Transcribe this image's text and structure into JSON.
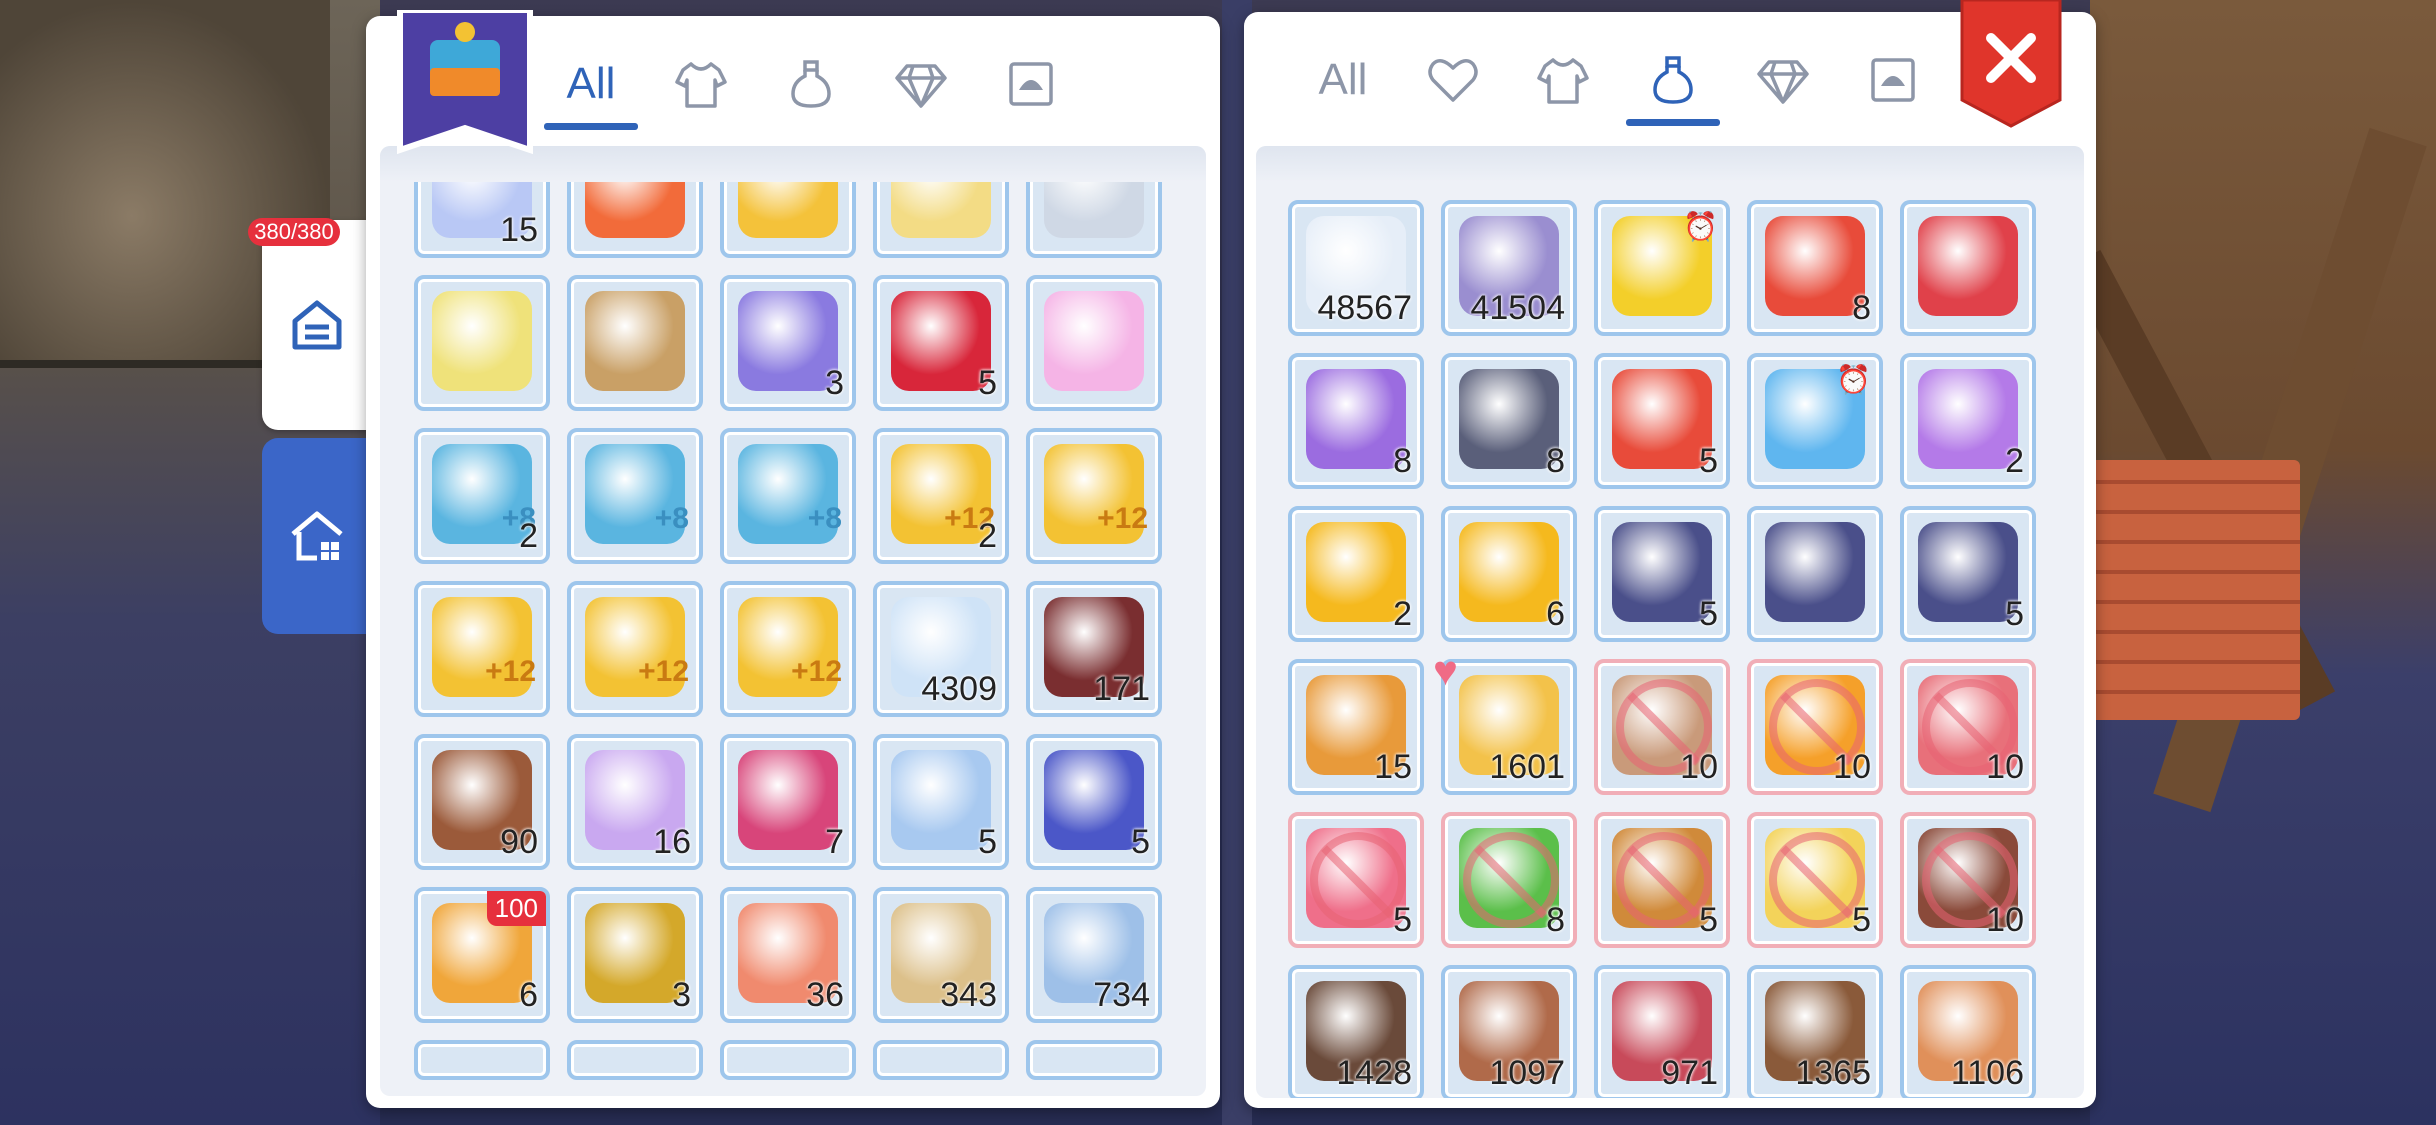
{
  "hud": {
    "hp_badge": "380/380"
  },
  "left_panel": {
    "tabs": [
      {
        "label": "All",
        "icon": "all-text",
        "active": true
      },
      {
        "label": "",
        "icon": "shirt-icon",
        "active": false
      },
      {
        "label": "",
        "icon": "potion-icon",
        "active": false
      },
      {
        "label": "",
        "icon": "diamond-icon",
        "active": false
      },
      {
        "label": "",
        "icon": "card-icon",
        "active": false
      }
    ],
    "items": [
      {
        "icon": "crystal-vial-icon",
        "count": "15",
        "color": "#b9c8f5"
      },
      {
        "icon": "red-ticket-icon",
        "count": "",
        "color": "#f26b3a"
      },
      {
        "icon": "gold-ticket-icon",
        "count": "",
        "color": "#f4c23a"
      },
      {
        "icon": "pale-gold-ticket-icon",
        "count": "",
        "color": "#f3dc85"
      },
      {
        "icon": "silver-ticket-icon",
        "count": "",
        "color": "#cfd8e5"
      },
      {
        "icon": "yellow-ticket-icon",
        "count": "",
        "color": "#efe27a"
      },
      {
        "icon": "brown-ticket-icon",
        "count": "",
        "color": "#c9a066"
      },
      {
        "icon": "blueprint-card-icon",
        "count": "3",
        "color": "#8a7ae0"
      },
      {
        "icon": "red-rose-icon",
        "count": "5",
        "color": "#d8263a"
      },
      {
        "icon": "pink-perfume-icon",
        "count": "",
        "color": "#f5b4e6"
      },
      {
        "icon": "blue-upgrade-boots-icon",
        "count": "2",
        "plus": "+8",
        "color": "#5ab5e0"
      },
      {
        "icon": "blue-upgrade-armor-icon",
        "count": "",
        "plus": "+8",
        "color": "#5ab5e0"
      },
      {
        "icon": "blue-upgrade-sword-icon",
        "count": "",
        "plus": "+8",
        "color": "#5ab5e0"
      },
      {
        "icon": "gold-upgrade-ring-icon",
        "count": "2",
        "plus": "+12",
        "color": "#f3c233"
      },
      {
        "icon": "gold-upgrade-boots-icon",
        "count": "",
        "plus": "+12",
        "color": "#f3c233"
      },
      {
        "icon": "gold-upgrade-cape-icon",
        "count": "",
        "plus": "+12",
        "color": "#f3c233"
      },
      {
        "icon": "gold-upgrade-armor-icon",
        "count": "",
        "plus": "+12",
        "color": "#f3c233"
      },
      {
        "icon": "gold-upgrade-shield-icon",
        "count": "",
        "plus": "+12",
        "color": "#f3c233"
      },
      {
        "icon": "ice-crystal-icon",
        "count": "4309",
        "color": "#cfe3f7"
      },
      {
        "icon": "bento-box-icon",
        "count": "171",
        "color": "#7a2e30"
      },
      {
        "icon": "lunch-box-icon",
        "count": "90",
        "color": "#9b5a3a"
      },
      {
        "icon": "purple-ghost-card-icon",
        "count": "16",
        "color": "#c9a8f0"
      },
      {
        "icon": "devil-book-icon",
        "count": "7",
        "color": "#d8457a"
      },
      {
        "icon": "crystal-scroll-icon",
        "count": "5",
        "color": "#a8c9f0"
      },
      {
        "icon": "star-wand-icon",
        "count": "5",
        "color": "#4b57c8"
      },
      {
        "icon": "gift-chest-icon",
        "count": "6",
        "badge": "100",
        "color": "#f0a63a"
      },
      {
        "icon": "gold-bar-icon",
        "count": "3",
        "color": "#d4a82a"
      },
      {
        "icon": "coral-ring-icon",
        "count": "36",
        "color": "#f08a6e"
      },
      {
        "icon": "parchment-map-icon",
        "count": "343",
        "color": "#dcc08a"
      },
      {
        "icon": "blue-cloth-icon",
        "count": "734",
        "color": "#9ec0e8"
      }
    ]
  },
  "right_panel": {
    "tabs": [
      {
        "label": "All",
        "icon": "all-text",
        "active": false
      },
      {
        "label": "",
        "icon": "heart-icon",
        "active": false
      },
      {
        "label": "",
        "icon": "shirt-icon",
        "active": false
      },
      {
        "label": "",
        "icon": "potion-icon",
        "active": true
      },
      {
        "label": "",
        "icon": "diamond-icon",
        "active": false
      },
      {
        "label": "",
        "icon": "card-icon",
        "active": false
      }
    ],
    "items": [
      {
        "icon": "white-feather-icon",
        "count": "48567",
        "color": "#e6eef8"
      },
      {
        "icon": "butterfly-wing-icon",
        "count": "41504",
        "color": "#9a8ed0"
      },
      {
        "icon": "yellow-ticket-icon",
        "count": "",
        "timed": true,
        "color": "#f3cf2a"
      },
      {
        "icon": "red-gift-box-icon",
        "count": "8",
        "color": "#e84b3a"
      },
      {
        "icon": "small-gift-icon",
        "count": "",
        "color": "#e0414a"
      },
      {
        "icon": "purple-gift-box-icon",
        "count": "8",
        "color": "#9b6ce0"
      },
      {
        "icon": "dark-gift-box-icon",
        "count": "8",
        "color": "#5a5f7a"
      },
      {
        "icon": "crown-gift-box-icon",
        "count": "5",
        "color": "#e84b3a"
      },
      {
        "icon": "blue-orb-icon",
        "count": "",
        "timed": true,
        "color": "#5fb6ef"
      },
      {
        "icon": "purple-orb-icon",
        "count": "2",
        "color": "#b47ae8"
      },
      {
        "icon": "star-coin-icon",
        "count": "2",
        "color": "#f5b91e"
      },
      {
        "icon": "question-coin-icon",
        "count": "6",
        "color": "#f5b91e"
      },
      {
        "icon": "treasure-chest-icon",
        "count": "5",
        "color": "#4a4f8a"
      },
      {
        "icon": "treasure-chest-icon",
        "count": "",
        "color": "#4a4f8a"
      },
      {
        "icon": "treasure-chest-icon",
        "count": "5",
        "color": "#4a4f8a"
      },
      {
        "icon": "sheriff-star-icon",
        "count": "15",
        "color": "#e89a3a"
      },
      {
        "icon": "mango-fruit-icon",
        "count": "1601",
        "favorite": true,
        "color": "#f3c24a"
      },
      {
        "icon": "latte-cup-icon",
        "count": "10",
        "forbidden": true,
        "color": "#c99a7a"
      },
      {
        "icon": "banana-icon",
        "count": "10",
        "forbidden": true,
        "color": "#f5a02a"
      },
      {
        "icon": "chocolate-heart-icon",
        "count": "10",
        "forbidden": true,
        "color": "#e8707a"
      },
      {
        "icon": "lollipop-icon",
        "count": "5",
        "forbidden": true,
        "color": "#ef6f8a"
      },
      {
        "icon": "green-potion-icon",
        "count": "8",
        "forbidden": true,
        "color": "#5bbf4a"
      },
      {
        "icon": "cookies-icon",
        "count": "5",
        "forbidden": true,
        "color": "#d08a3a"
      },
      {
        "icon": "parfait-icon",
        "count": "5",
        "forbidden": true,
        "color": "#f3d35a"
      },
      {
        "icon": "chocolate-sundae-icon",
        "count": "10",
        "forbidden": true,
        "color": "#8a4a3a"
      },
      {
        "icon": "cake-plate-icon",
        "count": "1428",
        "color": "#6a4a3a"
      },
      {
        "icon": "steak-plate-icon",
        "count": "1097",
        "color": "#b06a4a"
      },
      {
        "icon": "drumstick-icon",
        "count": "971",
        "color": "#c84a5a"
      },
      {
        "icon": "food-basket-icon",
        "count": "1365",
        "color": "#8a5a3a"
      },
      {
        "icon": "salad-plate-icon",
        "count": "1106",
        "color": "#e0905a"
      }
    ]
  }
}
